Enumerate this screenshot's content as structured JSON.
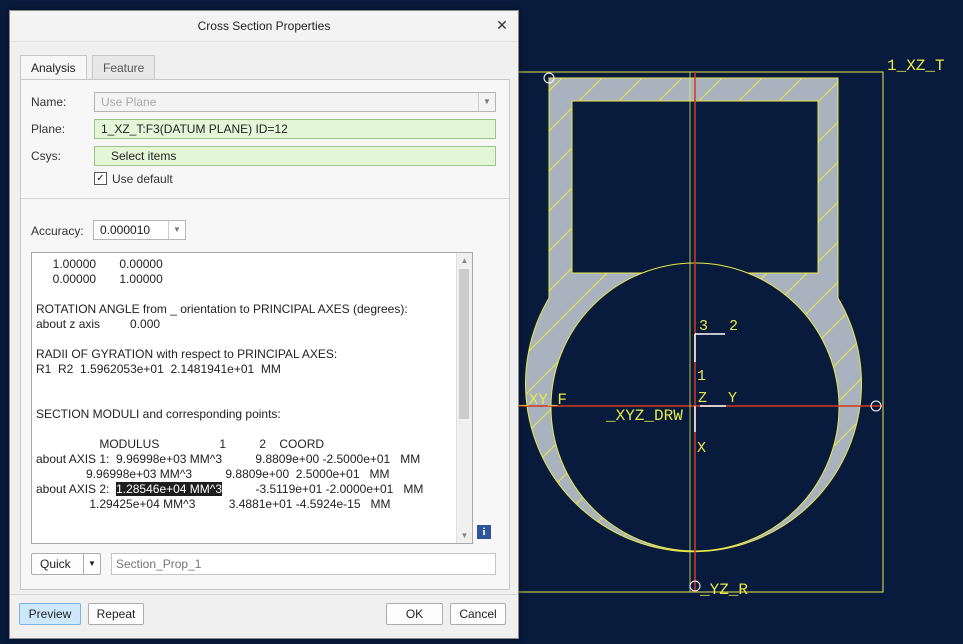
{
  "dialog": {
    "title": "Cross Section Properties",
    "close_icon": "close-icon"
  },
  "tabs": [
    {
      "label": "Analysis",
      "active": true
    },
    {
      "label": "Feature",
      "active": false
    }
  ],
  "form": {
    "name_label": "Name:",
    "name_value": "Use Plane",
    "plane_label": "Plane:",
    "plane_value": "1_XZ_T:F3(DATUM PLANE) ID=12",
    "csys_label": "Csys:",
    "csys_value": "Select items",
    "use_default_label": "Use default",
    "use_default_checked": true,
    "accuracy_label": "Accuracy:",
    "accuracy_value": "0.000010"
  },
  "results": {
    "lines_before": "     1.00000       0.00000\n     0.00000       1.00000\n\nROTATION ANGLE from _ orientation to PRINCIPAL AXES (degrees):\nabout z axis         0.000\n\nRADII OF GYRATION with respect to PRINCIPAL AXES:\nR1  R2  1.5962053e+01  2.1481941e+01  MM\n\n\nSECTION MODULI and corresponding points:\n\n                   MODULUS                  1          2    COORD\nabout AXIS 1:  9.96998e+03 MM^3          9.8809e+00 -2.5000e+01   MM\n               9.96998e+03 MM^3          9.8809e+00  2.5000e+01   MM\nabout AXIS 2:  ",
    "highlighted": "1.28546e+04 MM^3",
    "lines_after": "          -3.5119e+01 -2.0000e+01   MM\n                1.29425e+04 MM^3          3.4881e+01 -4.5924e-15   MM"
  },
  "bottom": {
    "quick_label": "Quick",
    "section_name_placeholder": "Section_Prop_1"
  },
  "footer": {
    "preview": "Preview",
    "repeat": "Repeat",
    "ok": "OK",
    "cancel": "Cancel"
  },
  "viewport_labels": {
    "top_right": "1_XZ_T",
    "left": "_XY_F",
    "center": "_XYZ_DRW",
    "bottom": "_YZ_R",
    "csys_3": "3",
    "csys_2": "2",
    "csys_1": "1",
    "csys_z": "Z",
    "csys_y": "Y",
    "csys_x": "X"
  },
  "colors": {
    "background": "#081b3d",
    "section_fill": "#a9b3c0",
    "datum_yellow": "#e8e84a",
    "axis_red": "#d23a1e",
    "ok_blue": "#cde8fb"
  }
}
